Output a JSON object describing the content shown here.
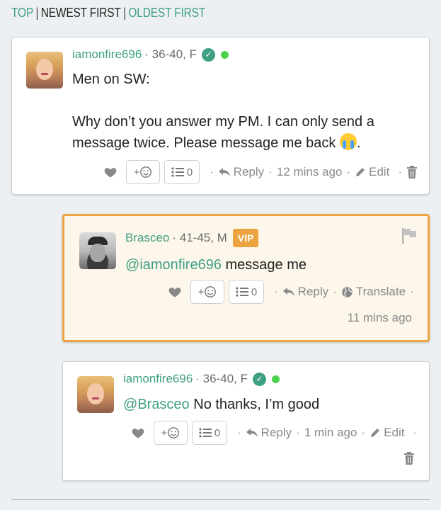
{
  "sort": {
    "options": [
      "TOP",
      "NEWEST FIRST",
      "OLDEST FIRST"
    ],
    "separator": "|"
  },
  "comments": [
    {
      "username": "iamonfire696",
      "demographics": "· 36-40, F",
      "verified": true,
      "online": true,
      "body_lines": [
        "Men on SW:",
        "",
        "Why don’t you answer my PM. I can only send a",
        "message twice. Please message me back"
      ],
      "trailing": ".",
      "emoji": "loudly-crying-face",
      "react_label": "+",
      "list_count": "0",
      "reply_label": "Reply",
      "time": "12 mins ago",
      "edit_label": "Edit"
    },
    {
      "username": "Brasceo",
      "demographics": "· 41-45, M",
      "badge": "VIP",
      "mention_prefix": "@",
      "mention": "iamonfire696",
      "body": " message me",
      "react_label": "+",
      "list_count": "0",
      "reply_label": "Reply",
      "translate_label": "Translate",
      "time": "11 mins ago"
    },
    {
      "username": "iamonfire696",
      "demographics": "· 36-40, F",
      "verified": true,
      "online": true,
      "mention_prefix": "@",
      "mention": "Brasceo",
      "body": " No thanks, I’m good",
      "react_label": "+",
      "list_count": "0",
      "reply_label": "Reply",
      "time": "1 min ago",
      "edit_label": "Edit"
    }
  ],
  "separator_dot": "·",
  "colors": {
    "accent": "#3e9f83",
    "vip": "#eba43f",
    "vip_bg": "#fdf6ea",
    "online": "#4cd14c",
    "page_bg": "#edf0f2"
  }
}
